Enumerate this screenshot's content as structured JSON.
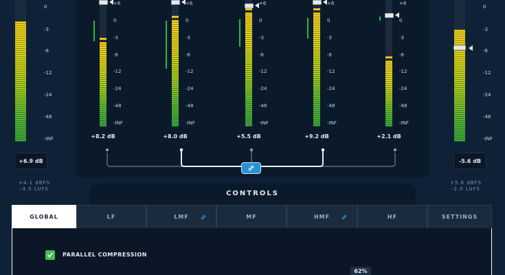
{
  "scale": [
    "+6",
    "0",
    "-3",
    "-6",
    "-12",
    "-24",
    "-48",
    "-INF"
  ],
  "side_scale": [
    "0",
    "-3",
    "-6",
    "-12",
    "-24",
    "-48",
    "-INF"
  ],
  "input": {
    "readout": "+6.9 dB",
    "dbfs": "+4.1 dBFS",
    "lufs": "-4.5 LUFS",
    "level_fraction": 0.85
  },
  "output": {
    "readout": "-5.6 dB",
    "dbfs": "+5.8 dBFS",
    "lufs": "-2.0 LUFS",
    "level_fraction": 0.79
  },
  "bands": [
    {
      "name": "LF",
      "readout": "+8.2 dB",
      "level_fraction": 0.67,
      "linked": true
    },
    {
      "name": "LMF",
      "readout": "+8.0 dB",
      "level_fraction": 0.84,
      "linked": true
    },
    {
      "name": "MF",
      "readout": "+5.5 dB",
      "level_fraction": 0.9,
      "linked": false
    },
    {
      "name": "HMF",
      "readout": "+9.2 dB",
      "level_fraction": 0.9,
      "linked": true
    },
    {
      "name": "HF",
      "readout": "+2.1 dB",
      "level_fraction": 0.52,
      "linked": false
    }
  ],
  "controls": {
    "title": "CONTROLS",
    "tabs": [
      "GLOBAL",
      "LF",
      "LMF",
      "MF",
      "HMF",
      "HF",
      "SETTINGS"
    ],
    "active_tab": "GLOBAL",
    "parallel_compression_label": "PARALLEL COMPRESSION",
    "parallel_compression_checked": true,
    "mix_value": "62%"
  },
  "colors": {
    "background": "#0f2136",
    "panel": "#0b1a2b",
    "accent_blue": "#2b8fd6",
    "check_green": "#3fbf4f"
  }
}
